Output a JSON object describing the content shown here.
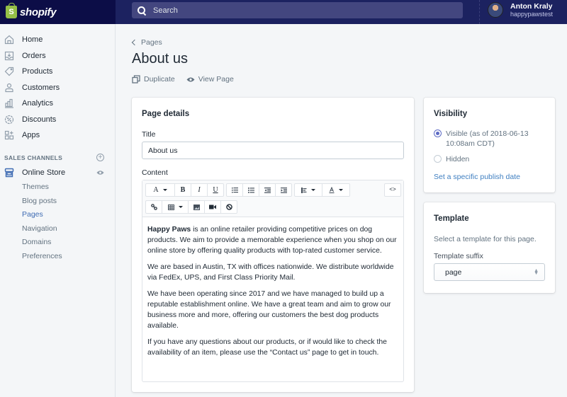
{
  "topbar": {
    "brand": "shopify",
    "search_placeholder": "Search",
    "user_name": "Anton Kraly",
    "user_store": "happypawstest"
  },
  "sidebar": {
    "items": [
      {
        "label": "Home",
        "icon": "home-icon"
      },
      {
        "label": "Orders",
        "icon": "orders-icon"
      },
      {
        "label": "Products",
        "icon": "tag-icon"
      },
      {
        "label": "Customers",
        "icon": "person-icon"
      },
      {
        "label": "Analytics",
        "icon": "bar-chart-icon"
      },
      {
        "label": "Discounts",
        "icon": "discount-icon"
      },
      {
        "label": "Apps",
        "icon": "apps-icon"
      }
    ],
    "sales_channels_title": "SALES CHANNELS",
    "online_store": "Online Store",
    "sub_items": [
      {
        "label": "Themes",
        "active": false
      },
      {
        "label": "Blog posts",
        "active": false
      },
      {
        "label": "Pages",
        "active": true
      },
      {
        "label": "Navigation",
        "active": false
      },
      {
        "label": "Domains",
        "active": false
      },
      {
        "label": "Preferences",
        "active": false
      }
    ]
  },
  "page": {
    "breadcrumb": "Pages",
    "title": "About us",
    "actions": {
      "duplicate": "Duplicate",
      "view_page": "View Page"
    }
  },
  "page_details": {
    "card_title": "Page details",
    "title_label": "Title",
    "title_value": "About us",
    "content_label": "Content",
    "toolbar": {
      "font": "A",
      "bold": "B",
      "italic": "I",
      "underline": "U",
      "source": "<>"
    },
    "content": {
      "p1_bold": "Happy Paws",
      "p1_rest": " is an online retailer providing competitive prices on dog products.  We aim to provide a memorable experience when you shop on our online store by offering quality products with top-rated customer service.",
      "p2": "We are based in Austin, TX with offices nationwide. We distribute worldwide via FedEx, UPS, and First Class Priority Mail.",
      "p3": "We have been operating since 2017 and we have managed to build up a reputable establishment online. We have a great team and aim to grow our business more and more, offering our customers the best dog products available.",
      "p4": "If you have any questions about our products, or if would like to check the availability of an item, please use the “Contact us” page to get in touch."
    }
  },
  "visibility": {
    "title": "Visibility",
    "visible_label": "Visible (as of 2018-06-13 10:08am CDT)",
    "visible_selected": true,
    "hidden_label": "Hidden",
    "publish_link": "Set a specific publish date"
  },
  "template": {
    "title": "Template",
    "description": "Select a template for this page.",
    "suffix_label": "Template suffix",
    "suffix_value": "page"
  },
  "colors": {
    "topbar": "#1c2260",
    "topbar_brand_area": "#0c0d47",
    "search_bg": "#43467f",
    "accent_link": "#3f7fc1",
    "active_nav": "#3f6cb3",
    "radio_selected": "#5c6ac4",
    "shopify_green": "#95bf47"
  }
}
